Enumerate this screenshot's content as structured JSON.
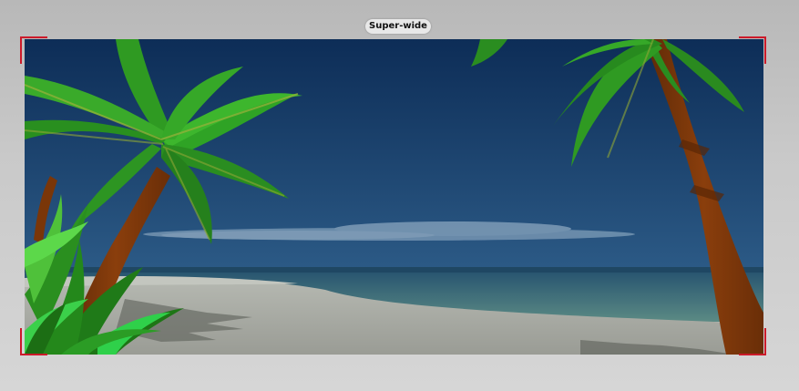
{
  "camera": {
    "aspect_mode_label": "Super-wide"
  },
  "colors": {
    "frame_corner": "#cc1a2a",
    "sky_top": "#0d2d57",
    "sky_bottom": "#2b5a86",
    "sand": "#9fa39c",
    "palm_leaf": "#2f9a22",
    "palm_trunk": "#7a3608"
  },
  "icons": {
    "frame_corners": "viewfinder-corner-brackets"
  }
}
